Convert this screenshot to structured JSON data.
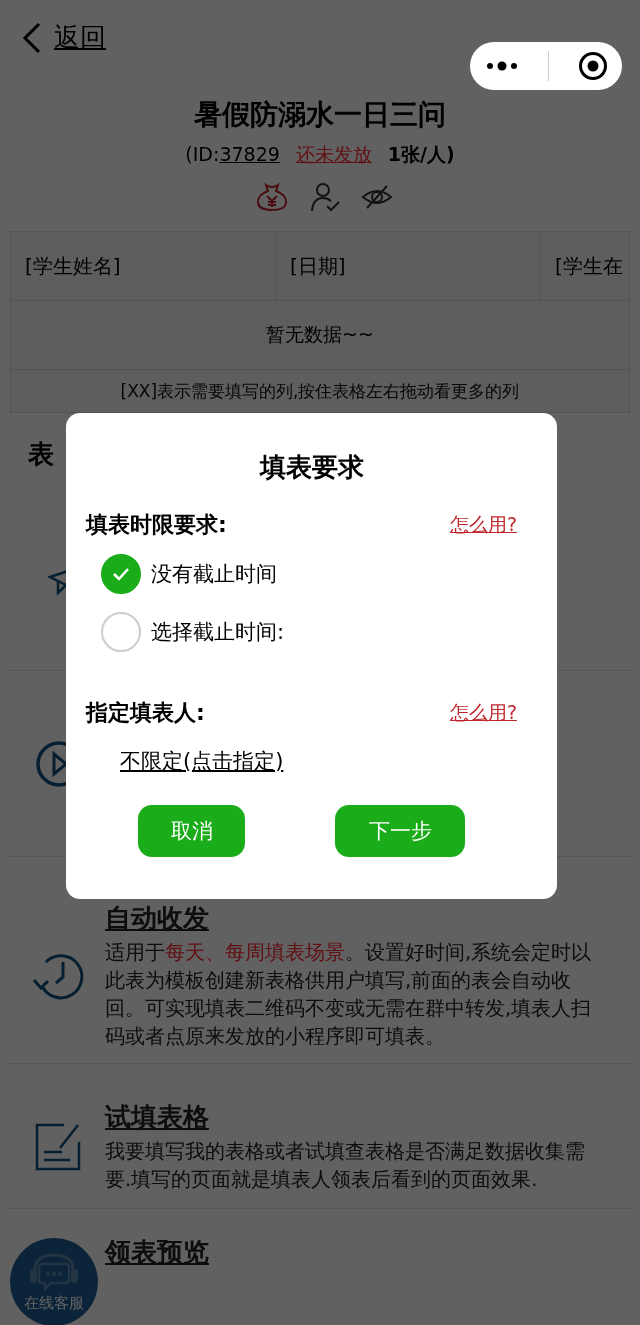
{
  "nav": {
    "back": "返回"
  },
  "form": {
    "title": "暑假防溺水一日三问",
    "id_prefix": "(ID:",
    "id": "37829",
    "status": "还未发放",
    "quota": "1张/人)"
  },
  "table": {
    "columns": [
      "[学生姓名]",
      "[日期]",
      "[学生在"
    ],
    "empty_text": "暂无数据~~",
    "hint": "[XX]表示需要填写的列,按住表格左右拖动看更多的列"
  },
  "section": {
    "heading": "表"
  },
  "features": [
    {
      "title": "自动收发",
      "description": [
        {
          "text": "适用于",
          "highlight": false
        },
        {
          "text": "每天、每周填表场景",
          "highlight": true
        },
        {
          "text": "。设置好时间,系统会定时以此表为模板创建新表格供用户填写,前面的表会自动收回。可实现填表二维码不变或无需在群中转发,填表人扫码或者点原来发放的小程序即可填表。",
          "highlight": false
        }
      ]
    },
    {
      "title": "试填表格",
      "description": [
        {
          "text": "我要填写我的表格或者试填查表格是否满足数据收集需要.填写的页面就是填表人领表后看到的页面效果.",
          "highlight": false
        }
      ]
    },
    {
      "title": "领表预览"
    }
  ],
  "support_button": {
    "label": "在线客服"
  },
  "dialog": {
    "title": "填表要求",
    "deadline": {
      "heading": "填表时限要求:",
      "help": "怎么用?",
      "options": [
        {
          "label": "没有截止时间",
          "selected": true
        },
        {
          "label": "选择截止时间:",
          "selected": false
        }
      ]
    },
    "assignee": {
      "heading": "指定填表人:",
      "help": "怎么用?",
      "value": "不限定(点击指定)"
    },
    "buttons": [
      "取消",
      "下一步"
    ]
  }
}
